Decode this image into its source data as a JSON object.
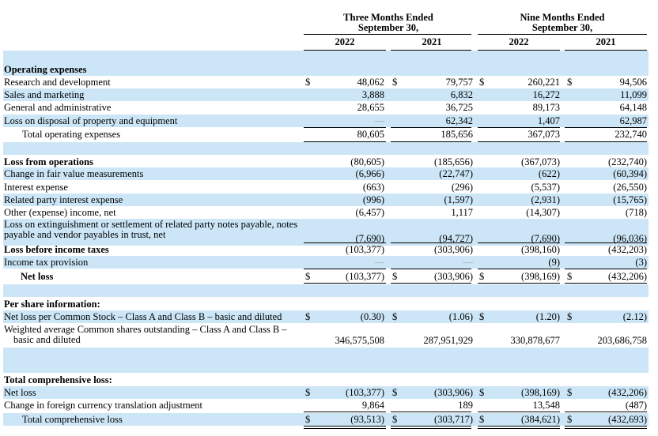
{
  "headers": {
    "group1": [
      "Three Months Ended",
      "September 30,"
    ],
    "group2": [
      "Nine Months Ended",
      "September 30,"
    ],
    "years": [
      "2022",
      "2021",
      "2022",
      "2021"
    ]
  },
  "sections": {
    "operating_expenses": "Operating expenses",
    "per_share": "Per share information:",
    "comprehensive": "Total comprehensive loss:"
  },
  "rows": {
    "rd": {
      "label": "Research and development",
      "v": [
        "48,062",
        "79,757",
        "260,221",
        "94,506"
      ]
    },
    "sm": {
      "label": "Sales and marketing",
      "v": [
        "3,888",
        "6,832",
        "16,272",
        "11,099"
      ]
    },
    "ga": {
      "label": "General and administrative",
      "v": [
        "28,655",
        "36,725",
        "89,173",
        "64,148"
      ]
    },
    "disp": {
      "label": "Loss on disposal of property and equipment",
      "v": [
        "—",
        "62,342",
        "1,407",
        "62,987"
      ]
    },
    "tope": {
      "label": "Total operating expenses",
      "v": [
        "80,605",
        "185,656",
        "367,073",
        "232,740"
      ]
    },
    "lfo": {
      "label": "Loss from operations",
      "v": [
        "(80,605)",
        "(185,656)",
        "(367,073)",
        "(232,740)"
      ]
    },
    "fv": {
      "label": "Change in fair value measurements",
      "v": [
        "(6,966)",
        "(22,747)",
        "(622)",
        "(60,394)"
      ]
    },
    "ie": {
      "label": "Interest expense",
      "v": [
        "(663)",
        "(296)",
        "(5,537)",
        "(26,550)"
      ]
    },
    "rpie": {
      "label": "Related party interest expense",
      "v": [
        "(996)",
        "(1,597)",
        "(2,931)",
        "(15,765)"
      ]
    },
    "oth": {
      "label": "Other (expense) income, net",
      "v": [
        "(6,457)",
        "1,117",
        "(14,307)",
        "(718)"
      ]
    },
    "ext": {
      "label1": "Loss on extinguishment or settlement of related party notes payable, notes",
      "label2": "payable and vendor payables in trust, net",
      "v": [
        "(7,690)",
        "(94,727)",
        "(7,690)",
        "(96,036)"
      ]
    },
    "lbt": {
      "label": "Loss before income taxes",
      "v": [
        "(103,377)",
        "(303,906)",
        "(398,160)",
        "(432,203)"
      ]
    },
    "tax": {
      "label": "Income tax provision",
      "v": [
        "—",
        "—",
        "(9)",
        "(3)"
      ]
    },
    "nl": {
      "label": "Net loss",
      "v": [
        "(103,377)",
        "(303,906)",
        "(398,169)",
        "(432,206)"
      ]
    },
    "eps": {
      "label": "Net loss per Common Stock – Class A and Class B – basic and diluted",
      "v": [
        "(0.30)",
        "(1.06)",
        "(1.20)",
        "(2.12)"
      ]
    },
    "wavg": {
      "label1": "Weighted average Common shares outstanding – Class A and Class B –",
      "label2": "basic and diluted",
      "v": [
        "346,575,508",
        "287,951,929",
        "330,878,677",
        "203,686,758"
      ]
    },
    "cnl": {
      "label": "Net loss",
      "v": [
        "(103,377)",
        "(303,906)",
        "(398,169)",
        "(432,206)"
      ]
    },
    "fx": {
      "label": "Change in foreign currency translation adjustment",
      "v": [
        "9,864",
        "189",
        "13,548",
        "(487)"
      ]
    },
    "tcl": {
      "label": "Total comprehensive loss",
      "v": [
        "(93,513)",
        "(303,717)",
        "(384,621)",
        "(432,693)"
      ]
    }
  },
  "currency": "$"
}
